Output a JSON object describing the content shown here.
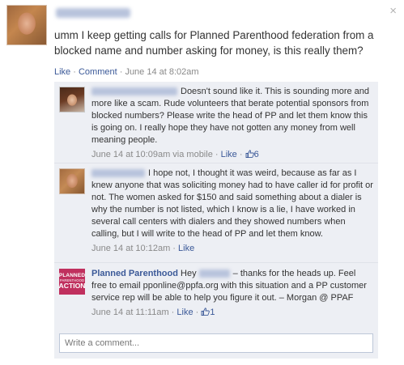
{
  "close_label": "×",
  "post": {
    "text": "umm I keep getting calls for Planned Parenthood federation from a blocked name and number asking for money, is this really them?",
    "actions": {
      "like": "Like",
      "comment": "Comment",
      "sep": " · ",
      "timestamp": "June 14 at 8:02am"
    }
  },
  "comments": [
    {
      "text": "Doesn't sound like it. This is sounding more and more like a scam. Rude volunteers that berate potential sponsors from blocked numbers? Please write the head of PP and let them know this is going on. I really hope they have not gotten any money from well meaning people.",
      "time": "June 14 at 10:09am via mobile",
      "like": "Like",
      "likes": "6",
      "thumb_icon": "thumbs-up-icon"
    },
    {
      "text": "I hope not, I thought it was weird, because as far as I knew anyone that was soliciting money had to have caller id for profit or not. The women asked for $150 and said something about a dialer is why the number is not listed, which I know is a lie, I have worked in several call centers with dialers and they showed numbers when calling, but I will write to the head of PP and let them know.",
      "time": "June 14 at 10:12am",
      "like": "Like"
    },
    {
      "author": "Planned Parenthood",
      "logo": {
        "line1": "PLANNED",
        "line2": "PARENTHOOD",
        "line3": "ACTION"
      },
      "text_before": "Hey",
      "text_after": "– thanks for the heads up. Feel free to email pponline@ppfa.org with this situation and a PP customer service rep will be able to help you figure it out. – Morgan @ PPAF",
      "time": "June 14 at 11:11am",
      "like": "Like",
      "likes": "1",
      "thumb_icon": "thumbs-up-icon"
    }
  ],
  "comment_input": {
    "placeholder": "Write a comment..."
  },
  "colors": {
    "link": "#3b5998",
    "meta": "#898989",
    "comment_bg": "#edeff4",
    "pp_brand": "#c0305e"
  }
}
